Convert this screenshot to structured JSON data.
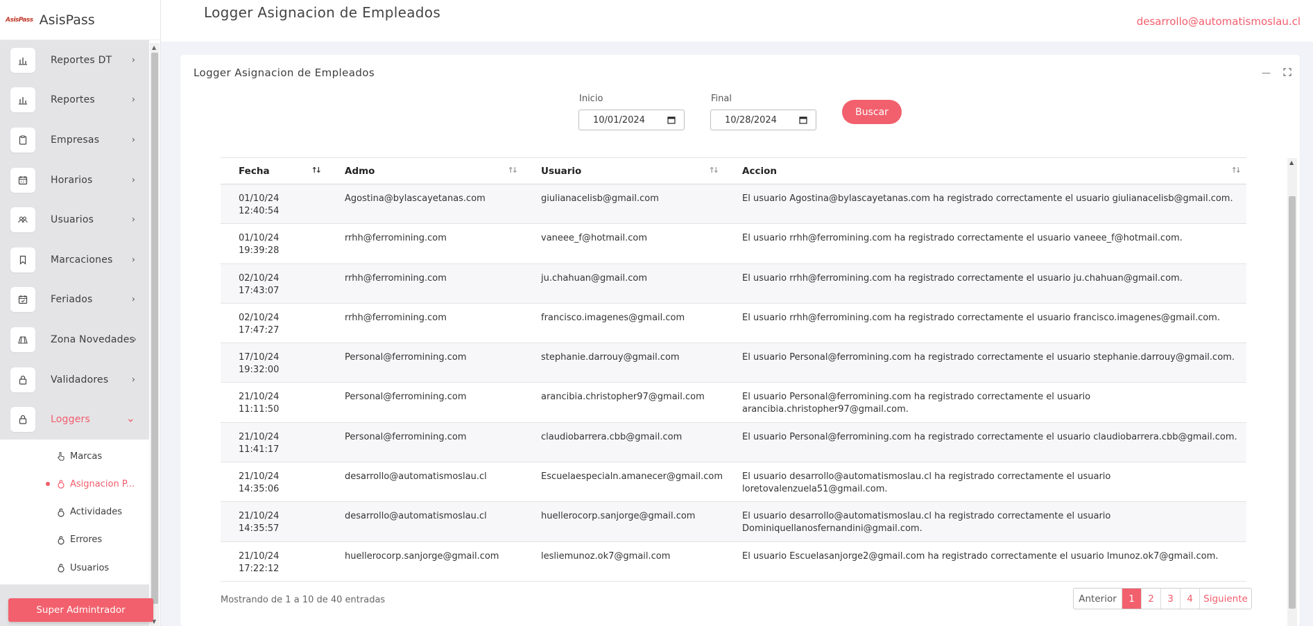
{
  "brand": {
    "logo": "AsisPass",
    "name": "AsisPass"
  },
  "header": {
    "title": "Logger Asignacion de Empleados",
    "user_email": "desarrollo@automatismoslau.cl"
  },
  "sidebar": {
    "items": [
      {
        "label": "Reportes DT",
        "icon": "bar-chart-icon",
        "chevron": "›"
      },
      {
        "label": "Reportes",
        "icon": "bar-chart-icon",
        "chevron": "›"
      },
      {
        "label": "Empresas",
        "icon": "clipboard-icon",
        "chevron": "›"
      },
      {
        "label": "Horarios",
        "icon": "calendar-icon",
        "chevron": "›"
      },
      {
        "label": "Usuarios",
        "icon": "users-icon",
        "chevron": "›"
      },
      {
        "label": "Marcaciones",
        "icon": "bookmark-icon",
        "chevron": "›"
      },
      {
        "label": "Feriados",
        "icon": "calendar-check-icon",
        "chevron": "›"
      },
      {
        "label": "Zona Novedades",
        "icon": "map-icon",
        "chevron": "›"
      },
      {
        "label": "Validadores",
        "icon": "lock-icon",
        "chevron": "›"
      },
      {
        "label": "Loggers",
        "icon": "lock-icon",
        "chevron": "⌄"
      }
    ],
    "submenu": [
      {
        "label": "Marcas"
      },
      {
        "label": "Asignacion P..."
      },
      {
        "label": "Actividades"
      },
      {
        "label": "Errores"
      },
      {
        "label": "Usuarios"
      }
    ],
    "role_button": "Super Admintrador"
  },
  "card": {
    "title": "Logger Asignacion de Empleados",
    "filters": {
      "start_label": "Inicio",
      "start_value": "10/01/2024",
      "end_label": "Final",
      "end_value": "10/28/2024",
      "search_button": "Buscar"
    }
  },
  "table": {
    "columns": [
      "Fecha",
      "Admo",
      "Usuario",
      "Accion"
    ],
    "rows": [
      {
        "date": "01/10/24",
        "time": "12:40:54",
        "admo": "Agostina@bylascayetanas.com",
        "usuario": "giulianacelisb@gmail.com",
        "accion": "El usuario Agostina@bylascayetanas.com ha registrado correctamente el usuario giulianacelisb@gmail.com."
      },
      {
        "date": "01/10/24",
        "time": "19:39:28",
        "admo": "rrhh@ferromining.com",
        "usuario": "vaneee_f@hotmail.com",
        "accion": "El usuario rrhh@ferromining.com ha registrado correctamente el usuario vaneee_f@hotmail.com."
      },
      {
        "date": "02/10/24",
        "time": "17:43:07",
        "admo": "rrhh@ferromining.com",
        "usuario": "ju.chahuan@gmail.com",
        "accion": "El usuario rrhh@ferromining.com ha registrado correctamente el usuario ju.chahuan@gmail.com."
      },
      {
        "date": "02/10/24",
        "time": "17:47:27",
        "admo": "rrhh@ferromining.com",
        "usuario": "francisco.imagenes@gmail.com",
        "accion": "El usuario rrhh@ferromining.com ha registrado correctamente el usuario francisco.imagenes@gmail.com."
      },
      {
        "date": "17/10/24",
        "time": "19:32:00",
        "admo": "Personal@ferromining.com",
        "usuario": "stephanie.darrouy@gmail.com",
        "accion": "El usuario Personal@ferromining.com ha registrado correctamente el usuario stephanie.darrouy@gmail.com."
      },
      {
        "date": "21/10/24",
        "time": "11:11:50",
        "admo": "Personal@ferromining.com",
        "usuario": "arancibia.christopher97@gmail.com",
        "accion": "El usuario Personal@ferromining.com ha registrado correctamente el usuario arancibia.christopher97@gmail.com."
      },
      {
        "date": "21/10/24",
        "time": "11:41:17",
        "admo": "Personal@ferromining.com",
        "usuario": "claudiobarrera.cbb@gmail.com",
        "accion": "El usuario Personal@ferromining.com ha registrado correctamente el usuario claudiobarrera.cbb@gmail.com."
      },
      {
        "date": "21/10/24",
        "time": "14:35:06",
        "admo": "desarrollo@automatismoslau.cl",
        "usuario": "Escuelaespecialn.amanecer@gmail.com",
        "accion": "El usuario desarrollo@automatismoslau.cl ha registrado correctamente el usuario loretovalenzuela51@gmail.com."
      },
      {
        "date": "21/10/24",
        "time": "14:35:57",
        "admo": "desarrollo@automatismoslau.cl",
        "usuario": "huellerocorp.sanjorge@gmail.com",
        "accion": "El usuario desarrollo@automatismoslau.cl ha registrado correctamente el usuario Dominiquellanosfernandini@gmail.com."
      },
      {
        "date": "21/10/24",
        "time": "17:22:12",
        "admo": "huellerocorp.sanjorge@gmail.com",
        "usuario": "lesliemunoz.ok7@gmail.com",
        "accion": "El usuario Escuelasanjorge2@gmail.com ha registrado correctamente el usuario lmunoz.ok7@gmail.com."
      }
    ],
    "info": "Mostrando de 1 a 10 de 40 entradas",
    "pagination": {
      "prev": "Anterior",
      "pages": [
        "1",
        "2",
        "3",
        "4"
      ],
      "current": "1",
      "next": "Siguiente"
    }
  },
  "colors": {
    "accent": "#f2606d",
    "menu_bg": "#e4e4e7",
    "page_bg": "#f2f3f8"
  }
}
